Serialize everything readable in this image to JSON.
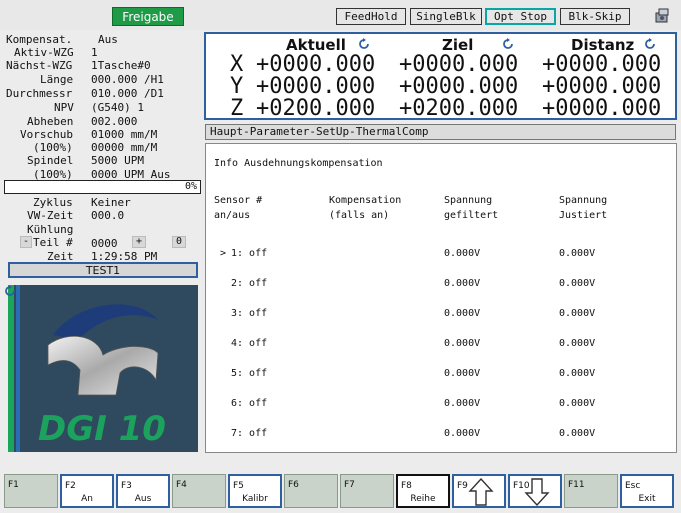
{
  "topbar": {
    "freigabe": "Freigabe",
    "buttons": [
      "FeedHold",
      "SingleBlk",
      "Opt Stop",
      "Blk-Skip"
    ]
  },
  "status": {
    "kompensat_label": "Kompensat.",
    "kompensat_value": "Aus",
    "aktiv_label": "Aktiv-WZG",
    "aktiv_value": "1",
    "naechst_label": "Nächst-WZG",
    "naechst_value": "1Tasche#0",
    "laenge_label": "Länge",
    "laenge_value": "000.000 /H1",
    "durchmessr_label": "Durchmessr",
    "durchmessr_value": "010.000 /D1",
    "npv_label": "NPV",
    "npv_value": "(G540) 1",
    "abheben_label": "Abheben",
    "abheben_value": "002.000",
    "vorschub_label": "Vorschub",
    "vorschub_value": "01000 mm/M",
    "vorschub_pct_label": "(100%)",
    "vorschub_pct_value": "00000 mm/M",
    "spindel_label": "Spindel",
    "spindel_value": "5000 UPM",
    "spindel_pct_label": "(100%)",
    "spindel_pct_value": "0000 UPM Aus",
    "progress_text": "0%",
    "progress": 0,
    "zyklus_label": "Zyklus",
    "zyklus_value": "Keiner",
    "vwzeit_label": "VW-Zeit",
    "vwzeit_value": "000.0",
    "kuehlung_label": "Kühlung",
    "teil_minus": "-",
    "teil_label": "Teil #",
    "teil_value": "0000",
    "teil_plus": "+",
    "teil_reset": "0",
    "zeit_label": "Zeit",
    "zeit_value": "1:29:58 PM",
    "program_name": "TEST1"
  },
  "logo": {
    "text": "DGI 10"
  },
  "dro": {
    "headers": [
      "Aktuell",
      "Ziel",
      "Distanz"
    ],
    "axes": [
      {
        "name": "X",
        "aktuell": "+0000.000",
        "ziel": "+0000.000",
        "distanz": "+0000.000"
      },
      {
        "name": "Y",
        "aktuell": "+0000.000",
        "ziel": "+0000.000",
        "distanz": "+0000.000"
      },
      {
        "name": "Z",
        "aktuell": "+0200.000",
        "ziel": "+0200.000",
        "distanz": "+0000.000"
      }
    ]
  },
  "tab_title": "Haupt-Parameter-SetUp-ThermalComp",
  "content": {
    "info": "Info Ausdehnungskompensation",
    "headers": [
      {
        "line1": "Sensor #",
        "line2": "an/aus"
      },
      {
        "line1": "Kompensation",
        "line2": "(falls an)"
      },
      {
        "line1": "Spannung",
        "line2": "gefiltert"
      },
      {
        "line1": "Spannung",
        "line2": "Justiert"
      }
    ],
    "rows": [
      {
        "marker": ">",
        "sensor": "1: off",
        "gefiltert": "0.000V",
        "justiert": "0.000V"
      },
      {
        "marker": "",
        "sensor": "2: off",
        "gefiltert": "0.000V",
        "justiert": "0.000V"
      },
      {
        "marker": "",
        "sensor": "3: off",
        "gefiltert": "0.000V",
        "justiert": "0.000V"
      },
      {
        "marker": "",
        "sensor": "4: off",
        "gefiltert": "0.000V",
        "justiert": "0.000V"
      },
      {
        "marker": "",
        "sensor": "5: off",
        "gefiltert": "0.000V",
        "justiert": "0.000V"
      },
      {
        "marker": "",
        "sensor": "6: off",
        "gefiltert": "0.000V",
        "justiert": "0.000V"
      },
      {
        "marker": "",
        "sensor": "7: off",
        "gefiltert": "0.000V",
        "justiert": "0.000V"
      }
    ]
  },
  "fkeys": [
    {
      "key": "F1",
      "label": ""
    },
    {
      "key": "F2",
      "label": "An"
    },
    {
      "key": "F3",
      "label": "Aus"
    },
    {
      "key": "F4",
      "label": ""
    },
    {
      "key": "F5",
      "label": "Kalibr"
    },
    {
      "key": "F6",
      "label": ""
    },
    {
      "key": "F7",
      "label": ""
    },
    {
      "key": "F8",
      "label": "Reihe"
    },
    {
      "key": "F9",
      "label": "",
      "icon": "arrow-up-icon"
    },
    {
      "key": "F10",
      "label": "",
      "icon": "arrow-down-icon"
    },
    {
      "key": "F11",
      "label": ""
    },
    {
      "key": "Esc",
      "label": "Exit"
    }
  ]
}
